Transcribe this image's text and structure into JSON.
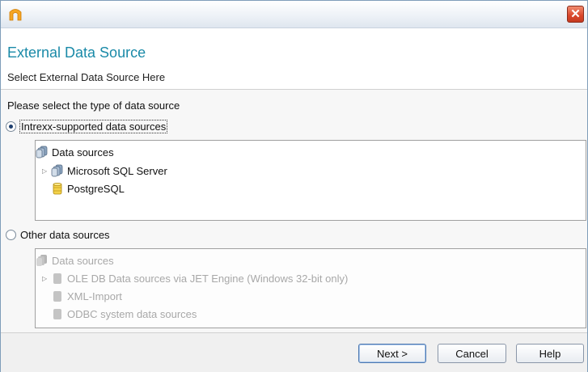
{
  "window": {
    "close_glyph": "✕"
  },
  "header": {
    "title": "External Data Source",
    "subtitle": "Select External Data Source Here"
  },
  "content": {
    "prompt": "Please select the type of data source",
    "supported": {
      "radio_label": "Intrexx-supported data sources",
      "selected": true,
      "tree_root": "Data sources",
      "items": [
        {
          "label": "Microsoft SQL Server",
          "expandable": true,
          "icon": "database-stack-icon"
        },
        {
          "label": "PostgreSQL",
          "expandable": false,
          "icon": "database-yellow-icon"
        }
      ]
    },
    "other": {
      "radio_label": "Other data sources",
      "selected": false,
      "tree_root": "Data sources",
      "items": [
        {
          "label": "OLE DB Data sources via JET Engine (Windows 32-bit only)",
          "expandable": true,
          "icon": "database-gray-icon"
        },
        {
          "label": "XML-Import",
          "expandable": false,
          "icon": "database-gray-icon"
        },
        {
          "label": "ODBC system data sources",
          "expandable": false,
          "icon": "database-gray-icon"
        }
      ]
    }
  },
  "footer": {
    "next_label": "Next >",
    "cancel_label": "Cancel",
    "help_label": "Help"
  },
  "colors": {
    "title_accent": "#1a8aa8",
    "close_button": "#d9452a",
    "selected_radio": "#1e3f6e",
    "disabled_text": "#a8a8a8"
  }
}
